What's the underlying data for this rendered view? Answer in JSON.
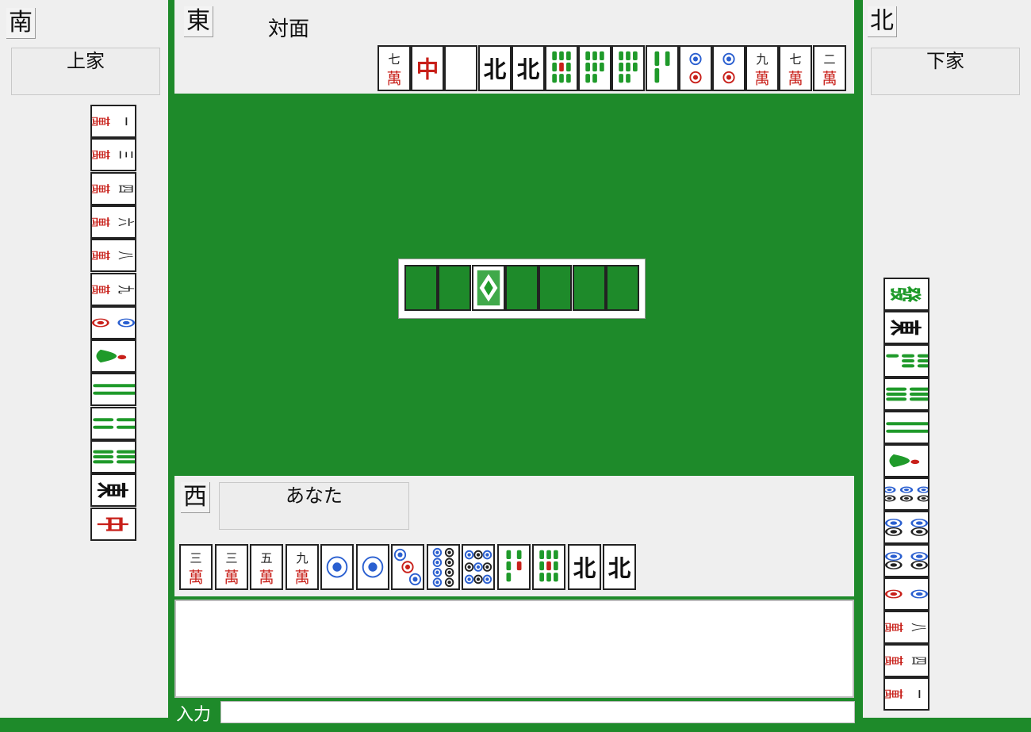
{
  "seats": {
    "left": {
      "wind": "南",
      "name": "上家"
    },
    "top": {
      "wind": "東",
      "name": "対面"
    },
    "right": {
      "wind": "北",
      "name": "下家"
    },
    "bottom": {
      "wind": "西",
      "name": "あなた"
    }
  },
  "top_hand": [
    "7-man",
    "red-dragon",
    "white-dragon",
    "north-wind",
    "north-wind",
    "9-sou",
    "8-sou",
    "8-sou",
    "3-sou",
    "2-pin",
    "2-pin",
    "9-man",
    "7-man",
    "2-man"
  ],
  "left_hand": [
    "1-man",
    "3-man",
    "4-man",
    "6-man",
    "8-man",
    "9-man",
    "2-pin",
    "1-sou",
    "2-sou",
    "4-sou",
    "6-sou",
    "east-wind",
    "red-dragon"
  ],
  "right_hand": [
    "green-dragon",
    "east-wind",
    "7-sou",
    "6-sou",
    "2-sou",
    "1-sou",
    "6-pin",
    "4-pin",
    "4-pin",
    "2-pin",
    "8-man",
    "4-man",
    "1-man"
  ],
  "player_hand": [
    {
      "tile": "3-man",
      "top": "三",
      "bottom": "萬"
    },
    {
      "tile": "3-man",
      "top": "三",
      "bottom": "萬"
    },
    {
      "tile": "5-man",
      "top": "伍",
      "bottom": "萬"
    },
    {
      "tile": "9-man",
      "top": "九",
      "bottom": "萬"
    },
    {
      "tile": "1-pin"
    },
    {
      "tile": "1-pin"
    },
    {
      "tile": "3-pin"
    },
    {
      "tile": "8-pin"
    },
    {
      "tile": "9-pin"
    },
    {
      "tile": "5-sou"
    },
    {
      "tile": "9-sou"
    },
    {
      "tile": "north-wind",
      "top": "北"
    },
    {
      "tile": "north-wind",
      "top": "北"
    }
  ],
  "dora_wall": {
    "slots": 7,
    "revealed_index": 2,
    "revealed_tile": "hidden-pattern"
  },
  "input": {
    "label": "入力",
    "value": ""
  },
  "colors": {
    "felt": "#1e8a2a",
    "panel": "#efefef",
    "man_red": "#c8201a",
    "sou_green": "#1f9a2a",
    "pin_blue": "#2a5fd0"
  }
}
